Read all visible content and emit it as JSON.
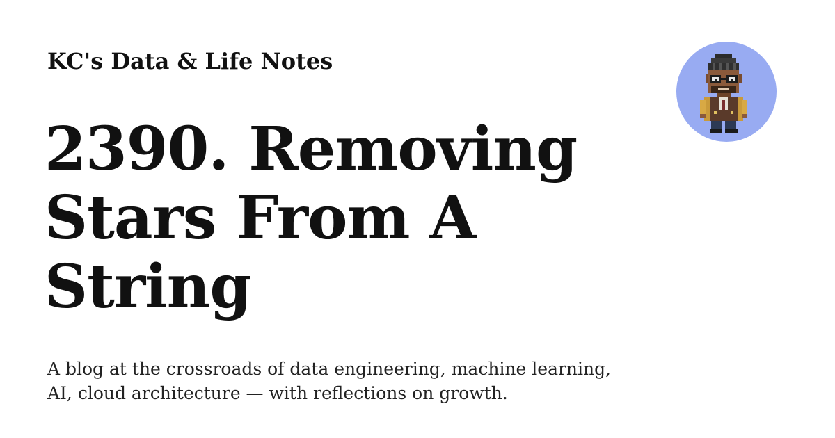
{
  "site": {
    "name": "KC's Data & Life Notes"
  },
  "post": {
    "title": "2390. Removing Stars From A String",
    "description": "A blog at the crossroads of data engineering, machine learning, AI, cloud architecture — with reflections on growth."
  },
  "avatar": {
    "icon": "pixel-art-person-with-glasses-icon",
    "background_color": "#98abf2"
  },
  "colors": {
    "background": "#ffffff",
    "text": "#111111"
  }
}
